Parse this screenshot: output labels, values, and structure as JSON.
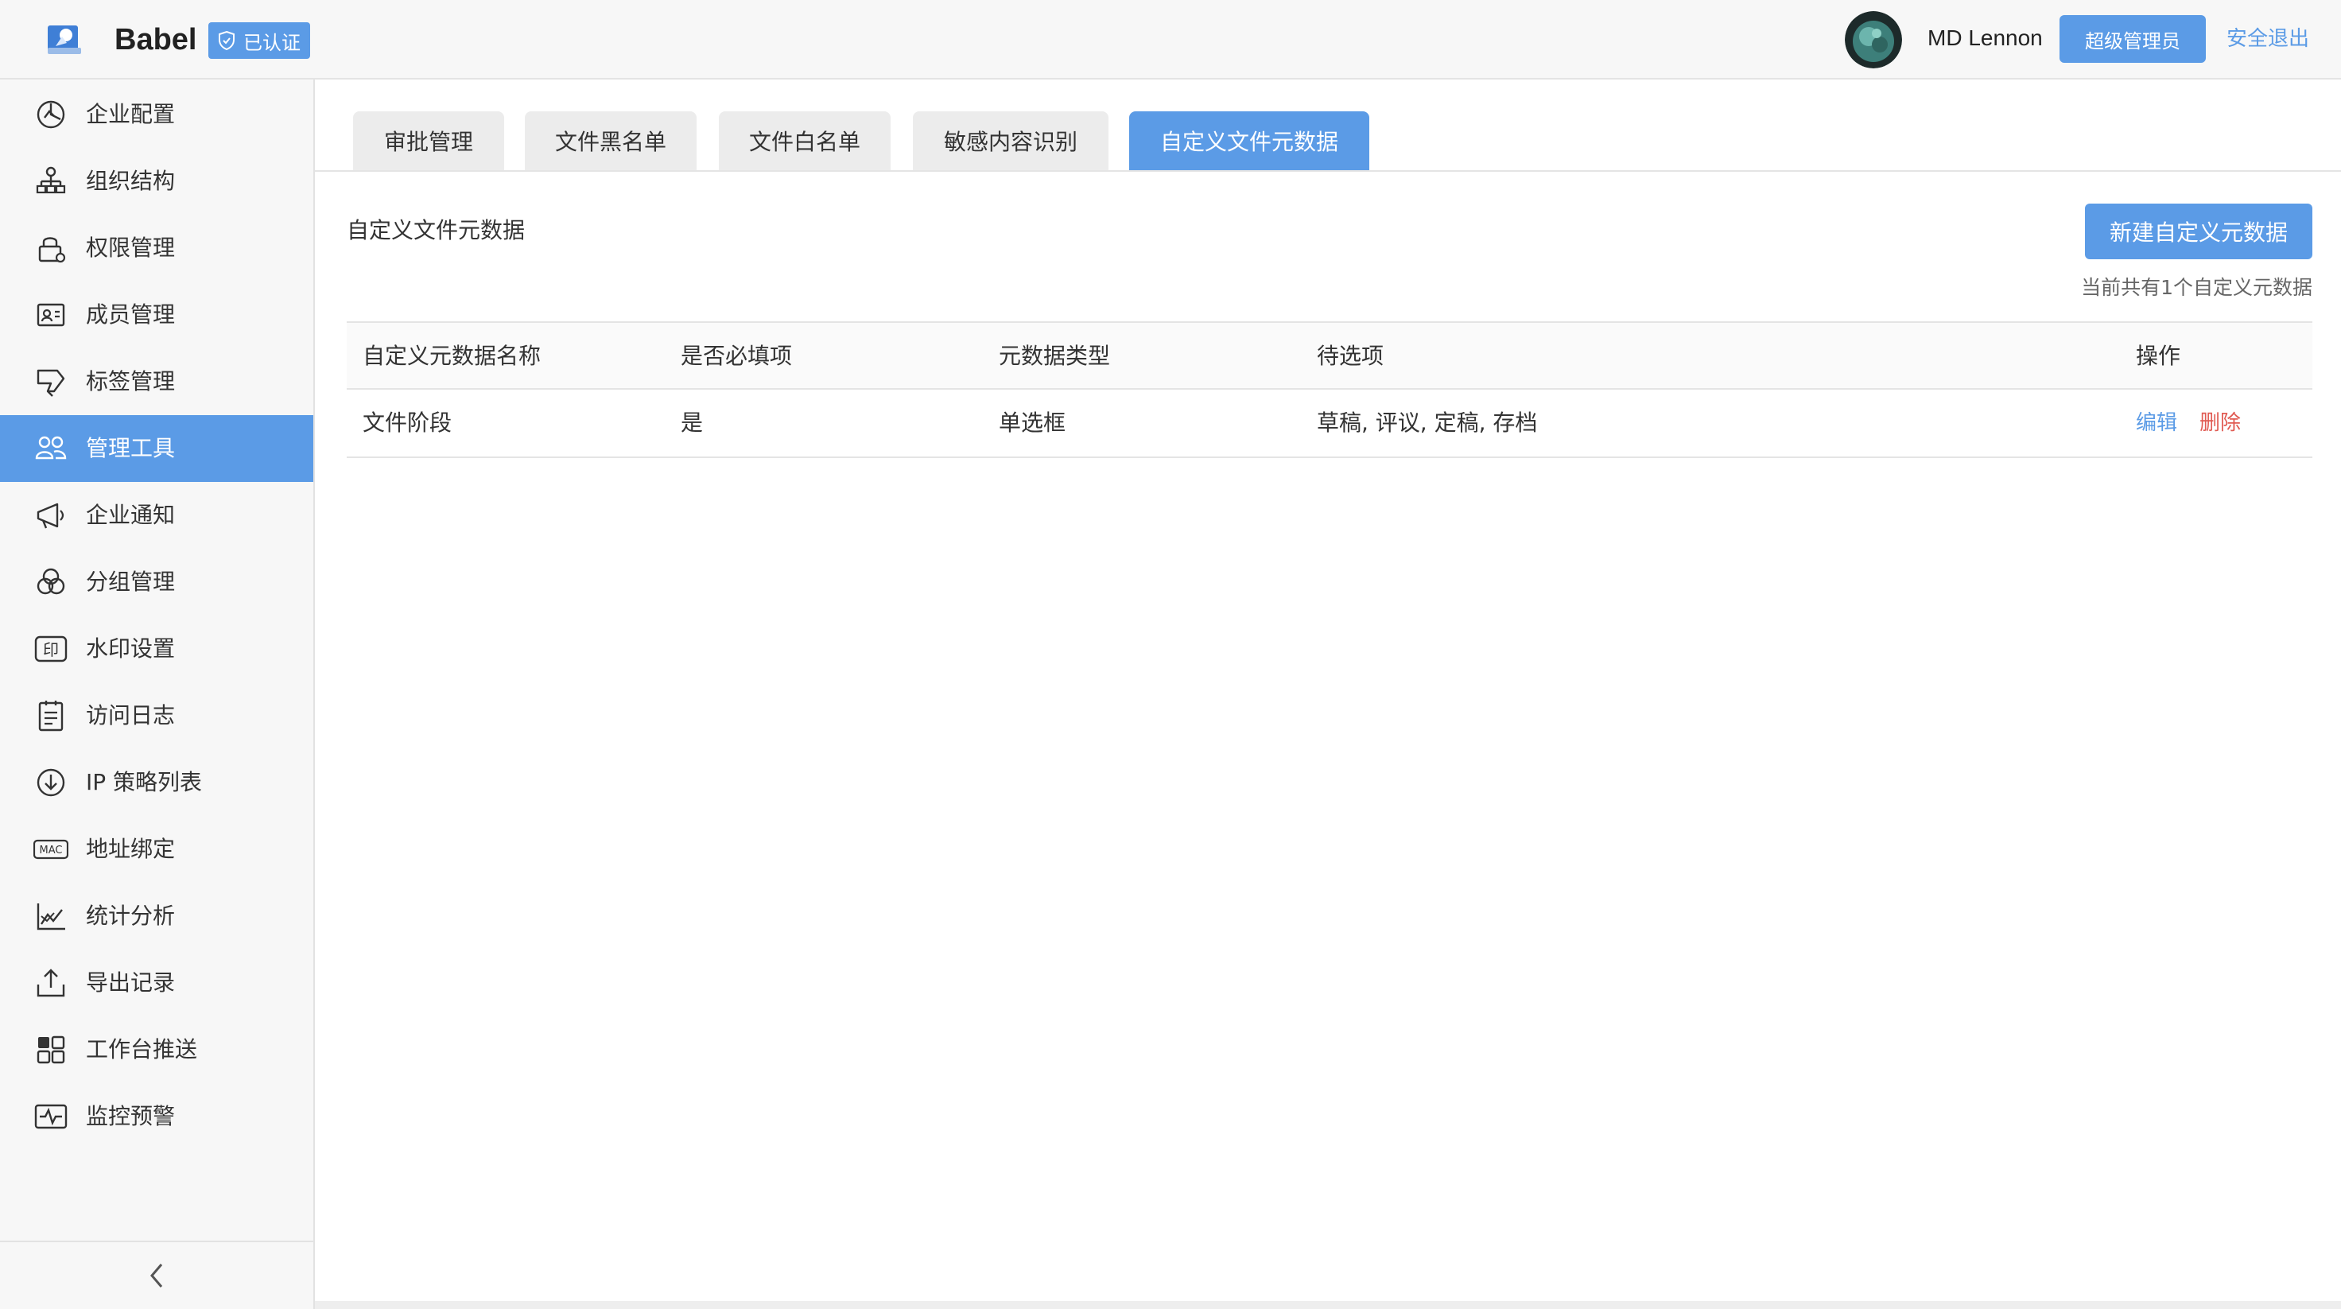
{
  "header": {
    "brand": "Babel",
    "verified_label": "已认证",
    "user_name": "MD Lennon",
    "role": "超级管理员",
    "logout": "安全退出"
  },
  "sidebar": {
    "items": [
      {
        "label": "企业配置",
        "icon": "enterprise-config-icon"
      },
      {
        "label": "组织结构",
        "icon": "org-structure-icon"
      },
      {
        "label": "权限管理",
        "icon": "permission-lock-icon"
      },
      {
        "label": "成员管理",
        "icon": "member-card-icon"
      },
      {
        "label": "标签管理",
        "icon": "tag-icon"
      },
      {
        "label": "管理工具",
        "icon": "admin-tools-icon",
        "active": true
      },
      {
        "label": "企业通知",
        "icon": "megaphone-icon"
      },
      {
        "label": "分组管理",
        "icon": "group-circles-icon"
      },
      {
        "label": "水印设置",
        "icon": "watermark-stamp-icon"
      },
      {
        "label": "访问日志",
        "icon": "access-log-icon"
      },
      {
        "label": "IP 策略列表",
        "icon": "ip-policy-icon"
      },
      {
        "label": "地址绑定",
        "icon": "mac-binding-icon"
      },
      {
        "label": "统计分析",
        "icon": "statistics-chart-icon"
      },
      {
        "label": "导出记录",
        "icon": "export-icon"
      },
      {
        "label": "工作台推送",
        "icon": "workbench-grid-icon"
      },
      {
        "label": "监控预警",
        "icon": "monitor-pulse-icon"
      }
    ],
    "mac_icon_text": "MAC",
    "watermark_icon_text": "印"
  },
  "tabs": [
    {
      "label": "审批管理"
    },
    {
      "label": "文件黑名单"
    },
    {
      "label": "文件白名单"
    },
    {
      "label": "敏感内容识别"
    },
    {
      "label": "自定义文件元数据",
      "active": true
    }
  ],
  "content": {
    "section_title": "自定义文件元数据",
    "new_button": "新建自定义元数据",
    "count_text": "当前共有1个自定义元数据"
  },
  "table": {
    "columns": [
      "自定义元数据名称",
      "是否必填项",
      "元数据类型",
      "待选项",
      "操作"
    ],
    "rows": [
      {
        "name": "文件阶段",
        "required": "是",
        "type": "单选框",
        "options": "草稿, 评议, 定稿, 存档",
        "actions": {
          "edit": "编辑",
          "delete": "删除"
        }
      }
    ]
  },
  "colors": {
    "accent": "#5b9be6",
    "danger": "#e05a52"
  }
}
